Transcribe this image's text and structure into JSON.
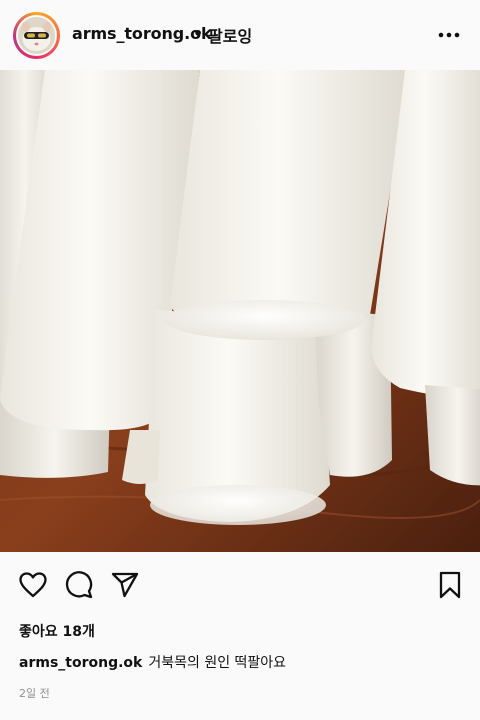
{
  "header": {
    "username": "arms_torong.ok",
    "separator": "•",
    "follow_label": "팔로잉",
    "avatar_icon": "hamster-avatar",
    "more_icon": "more-options-icon"
  },
  "post": {
    "image_subject": "rice-cake-photo",
    "likes_label": "좋아요 18개",
    "caption_user": "arms_torong.ok",
    "caption_text": "거북목의 원인 떡팔아요",
    "time_ago": "2일 전"
  },
  "actions": {
    "like_icon": "heart-icon",
    "comment_icon": "comment-icon",
    "share_icon": "send-icon",
    "save_icon": "bookmark-icon"
  },
  "colors": {
    "background": "#fafafa",
    "text": "#111111",
    "muted": "#8e8e8e"
  }
}
